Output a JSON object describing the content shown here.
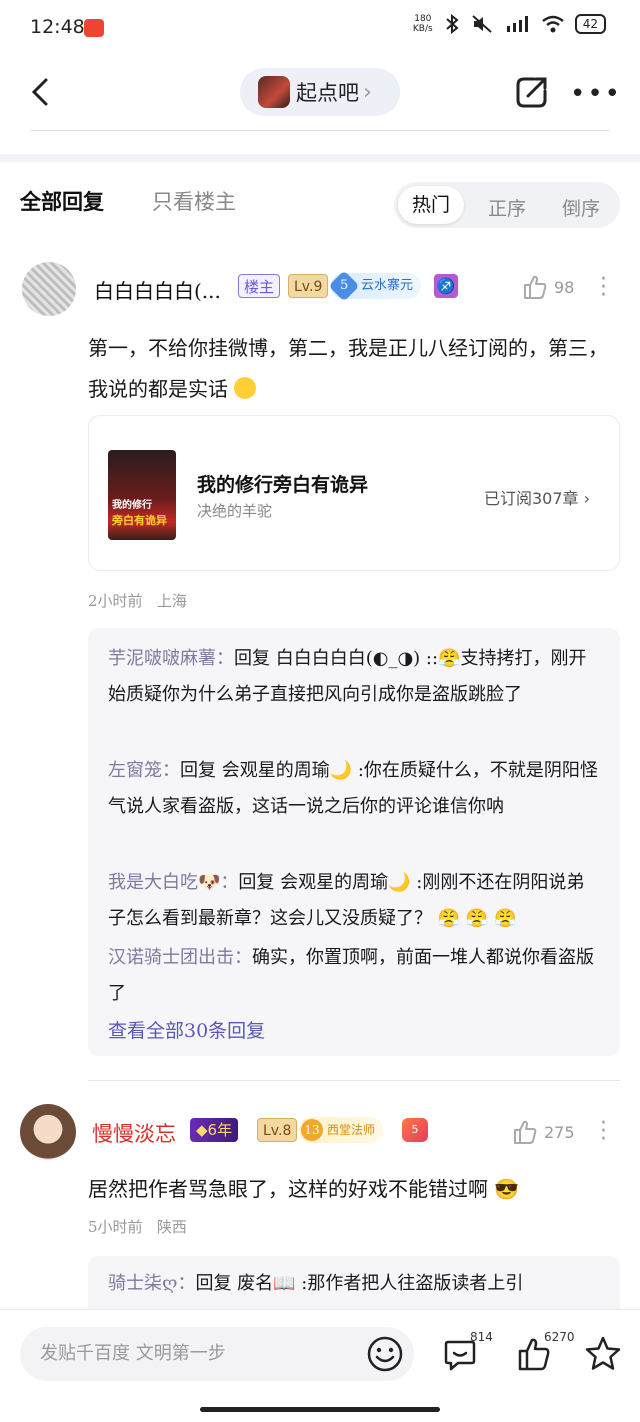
{
  "status_bar": {
    "time": "12:48",
    "speed_top": "180",
    "speed_bottom": "KB/s",
    "battery": "42"
  },
  "nav": {
    "forum_name": "起点吧"
  },
  "tabs": {
    "all": "全部回复",
    "op_only": "只看楼主",
    "sort_hot": "热门",
    "sort_asc": "正序",
    "sort_desc": "倒序"
  },
  "post1": {
    "username": "白白白白白(...",
    "badge_host": "楼主",
    "badge_level": "Lv.9",
    "badge_gem_num": "5",
    "badge_gem_title": "云水寨元",
    "zodiac": "♐",
    "likes": "98",
    "content": "第一，不给你挂微博，第二，我是正儿八经订阅的，第三，我说的都是实话",
    "book": {
      "title": "我的修行旁白有诡异",
      "author": "决绝的羊驼",
      "subscribed": "已订阅307章",
      "cover_line1": "我的修行",
      "cover_line2": "旁白有诡异"
    },
    "time": "2小时前",
    "location": "上海",
    "replies": [
      {
        "name": "芋泥啵啵麻薯：",
        "text": "回复 白白白白白(◐_◑) ::😤支持拷打，刚开始质疑你为什么弟子直接把风向引成你是盗版跳脸了"
      },
      {
        "name": "左窗笼：",
        "text": "回复 会观星的周瑜🌙 :你在质疑什么，不就是阴阳怪气说人家看盗版，这话一说之后你的评论谁信你呐"
      },
      {
        "name": "我是大白吃🐶：",
        "text": "回复 会观星的周瑜🌙 :刚刚不还在阴阳说弟子怎么看到最新章？这会儿又没质疑了？ 😤 😤 😤"
      },
      {
        "name": "汉诺骑士团出击：",
        "text": "确实，你置顶啊，前面一堆人都说你看盗版了"
      }
    ],
    "view_all": "查看全部30条回复"
  },
  "post2": {
    "username": "慢慢淡忘",
    "badge_years": "◆6年",
    "badge_level": "Lv.8",
    "badge_title_num": "13",
    "badge_title": "西堂法师",
    "likes": "275",
    "content": "居然把作者骂急眼了，这样的好戏不能错过啊 😎",
    "time": "5小时前",
    "location": "陕西",
    "reply": {
      "name": "骑士柒ღ：",
      "text": "回复 废名📖 :那作者把人往盗版读者上引"
    }
  },
  "bottom": {
    "placeholder": "发贴千百度 文明第一步",
    "comments": "814",
    "likes": "6270"
  },
  "colors": {
    "accent_purple": "#5b58b5",
    "vip_red": "#d9302c",
    "reply_name": "#7c7aa0"
  }
}
